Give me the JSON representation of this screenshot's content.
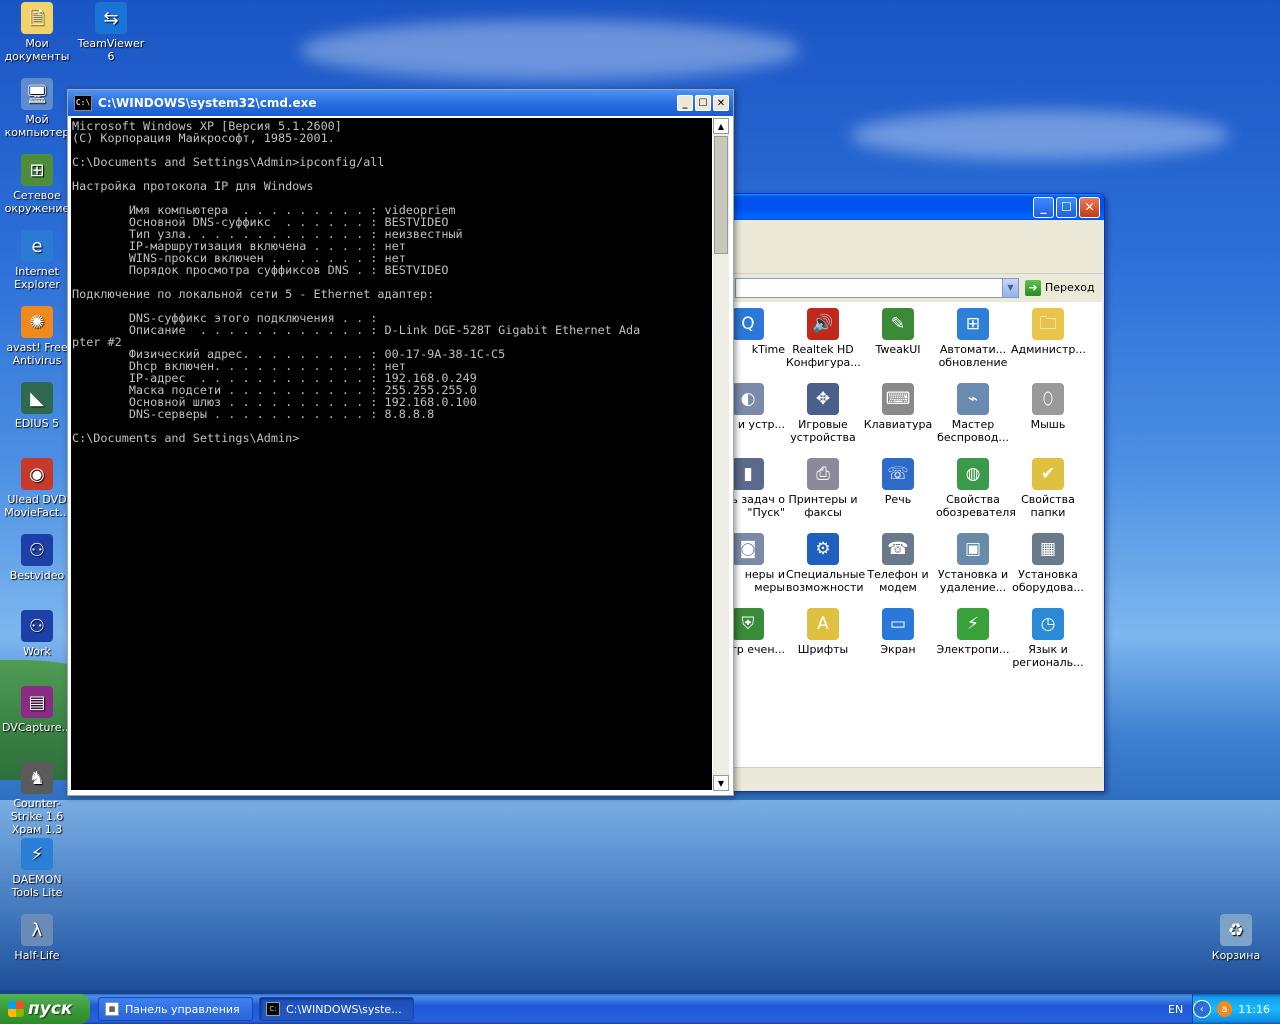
{
  "desktop": {
    "icons": [
      {
        "label": "Мои документы",
        "name": "my-documents-icon",
        "glyph": "🗎",
        "color": "#f2d36b"
      },
      {
        "label": "TeamViewer 6",
        "name": "teamviewer-icon",
        "glyph": "⇆",
        "color": "#1a74d8"
      },
      {
        "label": "Мой компьютер",
        "name": "my-computer-icon",
        "glyph": "🖥",
        "color": "#5f8bd1"
      },
      {
        "label": "Сетевое окружение",
        "name": "network-icon",
        "glyph": "⊞",
        "color": "#4d8d3c"
      },
      {
        "label": "Internet Explorer",
        "name": "internet-explorer-icon",
        "glyph": "e",
        "color": "#2b7ad6"
      },
      {
        "label": "avast! Free Antivirus",
        "name": "avast-icon",
        "glyph": "✺",
        "color": "#f08a1c"
      },
      {
        "label": "EDIUS 5",
        "name": "edius-icon",
        "glyph": "◣",
        "color": "#2f6a4e"
      },
      {
        "label": "Ulead DVD MovieFact...",
        "name": "ulead-dvd-icon",
        "glyph": "◉",
        "color": "#c73a2b"
      },
      {
        "label": "Bestvideo",
        "name": "bestvideo-icon",
        "glyph": "⚇",
        "color": "#1c40a8"
      },
      {
        "label": "Work",
        "name": "work-icon",
        "glyph": "⚇",
        "color": "#1c40a8"
      },
      {
        "label": "DVCapture...",
        "name": "dvcapture-icon",
        "glyph": "▤",
        "color": "#8a2b86"
      },
      {
        "label": "Counter-Strike 1.6 Храм 1.3",
        "name": "counter-strike-icon",
        "glyph": "♞",
        "color": "#5b5b5b"
      },
      {
        "label": "DAEMON Tools Lite",
        "name": "daemon-tools-icon",
        "glyph": "⚡",
        "color": "#2c7fd6"
      },
      {
        "label": "Half-Life",
        "name": "half-life-icon",
        "glyph": "λ",
        "color": "#6c8ab8"
      },
      {
        "label": "Корзина",
        "name": "recycle-bin-icon",
        "glyph": "♻",
        "color": "#7ea3c8"
      }
    ]
  },
  "cmd": {
    "title": "C:\\WINDOWS\\system32\\cmd.exe",
    "icon_text": "C:\\",
    "lines": [
      "Microsoft Windows XP [Версия 5.1.2600]",
      "(С) Корпорация Майкрософт, 1985-2001.",
      "",
      "C:\\Documents and Settings\\Admin>ipconfig/all",
      "",
      "Настройка протокола IP для Windows",
      "",
      "        Имя компьютера  . . . . . . . . . : videopriem",
      "        Основной DNS-суффикс  . . . . . . : BESTVIDEO",
      "        Тип узла. . . . . . . . . . . . . : неизвестный",
      "        IP-маршрутизация включена . . . . : нет",
      "        WINS-прокси включен . . . . . . . : нет",
      "        Порядок просмотра суффиксов DNS . : BESTVIDEO",
      "",
      "Подключение по локальной сети 5 - Ethernet адаптер:",
      "",
      "        DNS-суффикс этого подключения . . :",
      "        Описание  . . . . . . . . . . . . : D-Link DGE-528T Gigabit Ethernet Ada",
      "pter #2",
      "        Физический адрес. . . . . . . . . : 00-17-9A-38-1C-C5",
      "        Dhcp включен. . . . . . . . . . . : нет",
      "        IP-адрес  . . . . . . . . . . . . : 192.168.0.249",
      "        Маска подсети . . . . . . . . . . : 255.255.255.0",
      "        Основной шлюз . . . . . . . . . . : 192.168.0.100",
      "        DNS-серверы . . . . . . . . . . . : 8.8.8.8",
      "",
      "C:\\Documents and Settings\\Admin>"
    ]
  },
  "control_panel": {
    "go_label": "Переход",
    "items": [
      {
        "label": "kTime",
        "name": "quicktime-icon",
        "glyph": "Q",
        "color": "#2a78d8"
      },
      {
        "label": "Realtek HD Конфигура...",
        "name": "realtek-hd-icon",
        "glyph": "🔊",
        "color": "#c0281c"
      },
      {
        "label": "TweakUI",
        "name": "tweakui-icon",
        "glyph": "✎",
        "color": "#3a8a3a"
      },
      {
        "label": "Автомати... обновление",
        "name": "automatic-updates-icon",
        "glyph": "⊞",
        "color": "#2e7fd8"
      },
      {
        "label": "Администр...",
        "name": "administrative-tools-icon",
        "glyph": "🗀",
        "color": "#e8c44a"
      },
      {
        "label": "уки и устр...",
        "name": "sounds-devices-icon",
        "glyph": "◐",
        "color": "#7a8aa8"
      },
      {
        "label": "Игровые устройства",
        "name": "game-controllers-icon",
        "glyph": "✥",
        "color": "#4a5f8a"
      },
      {
        "label": "Клавиатура",
        "name": "keyboard-icon",
        "glyph": "⌨",
        "color": "#8a8a8a"
      },
      {
        "label": "Мастер беспровод...",
        "name": "wireless-wizard-icon",
        "glyph": "⌁",
        "color": "#6a8ab0"
      },
      {
        "label": "Мышь",
        "name": "mouse-icon",
        "glyph": "⬯",
        "color": "#9a9a9a"
      },
      {
        "label": "ь задач о \"Пуск\"",
        "name": "taskbar-start-menu-icon",
        "glyph": "▮",
        "color": "#5a6a8a"
      },
      {
        "label": "Принтеры и факсы",
        "name": "printers-faxes-icon",
        "glyph": "⎙",
        "color": "#8a8a9a"
      },
      {
        "label": "Речь",
        "name": "speech-icon",
        "glyph": "☏",
        "color": "#2e6ac8"
      },
      {
        "label": "Свойства обозревателя",
        "name": "internet-options-icon",
        "glyph": "◍",
        "color": "#3a9a4a"
      },
      {
        "label": "Свойства папки",
        "name": "folder-options-icon",
        "glyph": "✔",
        "color": "#e0c040"
      },
      {
        "label": "неры и меры",
        "name": "scanners-cameras-icon",
        "glyph": "◙",
        "color": "#7a8aa8"
      },
      {
        "label": "Специальные возможности",
        "name": "accessibility-icon",
        "glyph": "⚙",
        "color": "#1f5fc0"
      },
      {
        "label": "Телефон и модем",
        "name": "phone-modem-icon",
        "glyph": "☎",
        "color": "#6a7a8a"
      },
      {
        "label": "Установка и удаление...",
        "name": "add-remove-programs-icon",
        "glyph": "▣",
        "color": "#6a8aaa"
      },
      {
        "label": "Установка оборудова...",
        "name": "add-hardware-icon",
        "glyph": "▦",
        "color": "#6a7a8a"
      },
      {
        "label": "нтр ечен...",
        "name": "security-center-icon",
        "glyph": "⛨",
        "color": "#3a8a3a"
      },
      {
        "label": "Шрифты",
        "name": "fonts-icon",
        "glyph": "A",
        "color": "#e0c040"
      },
      {
        "label": "Экран",
        "name": "display-icon",
        "glyph": "▭",
        "color": "#2a78d8"
      },
      {
        "label": "Электропи...",
        "name": "power-options-icon",
        "glyph": "⚡",
        "color": "#3aa03a"
      },
      {
        "label": "Язык и региональ...",
        "name": "regional-options-icon",
        "glyph": "◷",
        "color": "#2a8ad8"
      }
    ]
  },
  "taskbar": {
    "start_label": "пуск",
    "tasks": [
      {
        "label": "Панель управления",
        "active": false
      },
      {
        "label": "C:\\WINDOWS\\syste...",
        "active": true
      }
    ],
    "language": "EN",
    "clock": "11:16"
  }
}
